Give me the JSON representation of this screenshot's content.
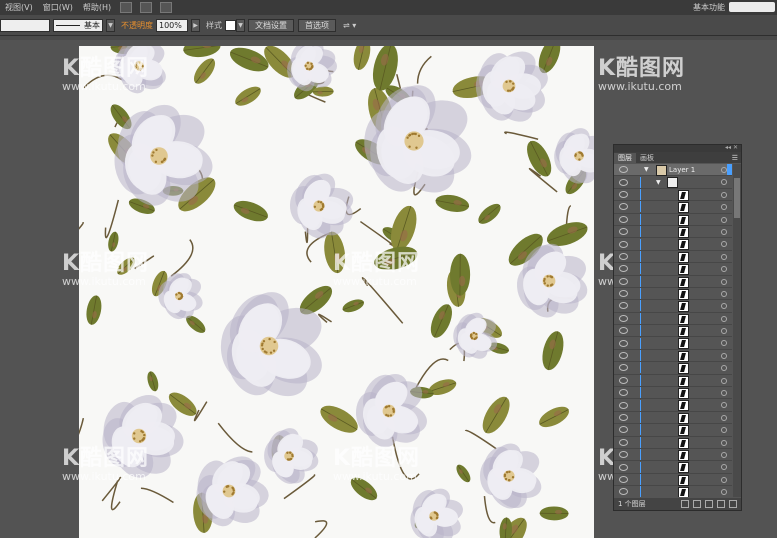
{
  "menubar": {
    "items": [
      "视图(V)",
      "窗口(W)",
      "帮助(H)"
    ],
    "workspace": "基本功能"
  },
  "ctrlbar": {
    "stroke_preset": "基本",
    "opacity_label": "不透明度",
    "opacity_value": "100%",
    "style_label": "样式",
    "doc_setup": "文档设置",
    "preferences": "首选项"
  },
  "watermark": {
    "brand": "K酷图网",
    "url": "www.ikutu.com"
  },
  "layers_panel": {
    "tabs": [
      "图层",
      "画板"
    ],
    "active_tab": "图层",
    "layer_name": "Layer 1",
    "footer_count": "1 个图层"
  },
  "colors": {
    "accent_blue": "#4aa0ff",
    "opacity_label": "#e8902e",
    "leaf_green": "#8a8a3a",
    "flower_white": "#e8e6ee"
  }
}
